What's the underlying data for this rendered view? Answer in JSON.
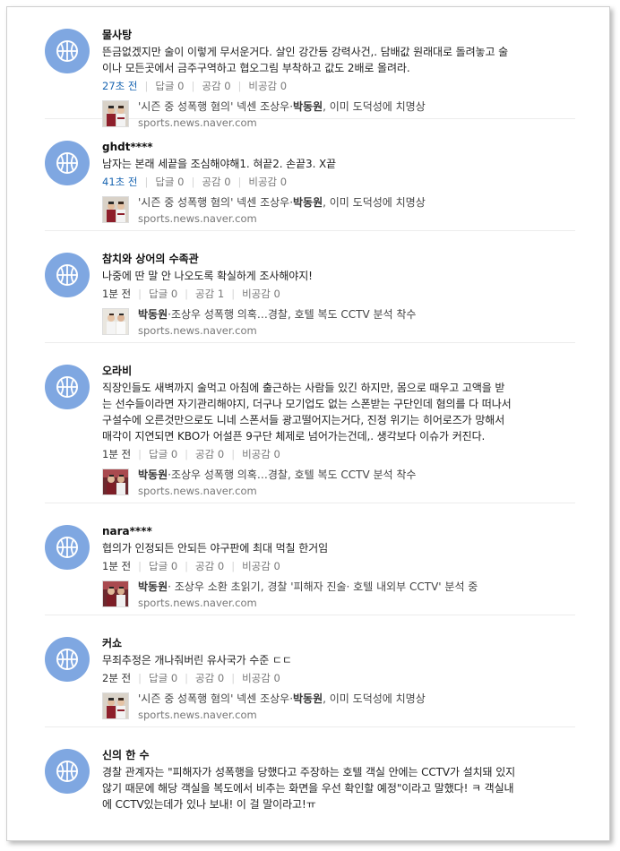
{
  "labels": {
    "reply": "답글",
    "like": "공감",
    "dislike": "비공감"
  },
  "colors": {
    "avatar_bg": "#7fa7e1",
    "recent_time": "#1a66b2"
  },
  "comments": [
    {
      "nick": "물사탕",
      "lines": [
        "뜬금없겠지만 술이 이렇게 무서운거다. 살인 강간등 강력사건,. 담배값 원래대로 돌려놓고 술",
        "이나 모든곳에서 금주구역하고 협오그림 부착하고 값도 2배로 올려라."
      ],
      "time": "27초 전",
      "time_recent": true,
      "replies": "0",
      "likes": "0",
      "dislikes": "0",
      "news": {
        "pre": "'시즌 중 성폭행 혐의' 넥센 조상우·",
        "bold": "박동원",
        "post": ", 이미 도덕성에 치명상",
        "url": "sports.news.naver.com",
        "thumb": "a"
      }
    },
    {
      "nick": "ghdt****",
      "lines": [
        "남자는 본래 세끝을 조심해야해1. 혀끝2. 손끝3. X끝"
      ],
      "time": "41초 전",
      "time_recent": true,
      "replies": "0",
      "likes": "0",
      "dislikes": "0",
      "news": {
        "pre": "'시즌 중 성폭행 혐의' 넥센 조상우·",
        "bold": "박동원",
        "post": ", 이미 도덕성에 치명상",
        "url": "sports.news.naver.com",
        "thumb": "a"
      }
    },
    {
      "nick": "참치와 상어의 수족관",
      "lines": [
        "나중에 딴 말 안 나오도록 확실하게 조사해야지!"
      ],
      "time": "1분 전",
      "time_recent": false,
      "replies": "0",
      "likes": "1",
      "dislikes": "0",
      "news": {
        "pre": "",
        "bold": "박동원",
        "post": "·조상우 성폭행 의혹…경찰, 호텔 복도 CCTV 분석 착수",
        "url": "sports.news.naver.com",
        "thumb": "b"
      }
    },
    {
      "nick": "오라비",
      "lines": [
        "직장인들도 새벽까지 술먹고 아침에 출근하는 사람들 있긴 하지만, 몸으로 때우고 고액을 받",
        "는 선수들이라면 자기관리해야지, 더구나 모기업도 없는 스폰받는 구단인데 혐의를 다 떠나서",
        "구설수에 오른것만으로도 니네 스폰서들 광고떨어지는거다, 진정 위기는 히어로즈가 망해서",
        "매각이 지연되면 KBO가 어설픈 9구단 체제로 넘어가는건데,. 생각보다 이슈가 커진다."
      ],
      "time": "1분 전",
      "time_recent": false,
      "replies": "0",
      "likes": "0",
      "dislikes": "0",
      "news": {
        "pre": "",
        "bold": "박동원",
        "post": "·조상우 성폭행 의혹…경찰, 호텔 복도 CCTV 분석 착수",
        "url": "sports.news.naver.com",
        "thumb": "c"
      }
    },
    {
      "nick": "nara****",
      "lines": [
        "협의가 인정되든 안되든 야구판에 최대 먹칠 한거임"
      ],
      "time": "1분 전",
      "time_recent": false,
      "replies": "0",
      "likes": "0",
      "dislikes": "0",
      "news": {
        "pre": "",
        "bold": "박동원",
        "post": "· 조상우 소환 초읽기, 경찰 '피해자 진술· 호텔 내외부 CCTV' 분석 중",
        "url": "sports.news.naver.com",
        "thumb": "c"
      }
    },
    {
      "nick": "커쇼",
      "lines": [
        "무죄추정은 개나줘버린 유사국가 수준 ㄷㄷ"
      ],
      "time": "2분 전",
      "time_recent": false,
      "replies": "0",
      "likes": "0",
      "dislikes": "0",
      "news": {
        "pre": "'시즌 중 성폭행 혐의' 넥센 조상우·",
        "bold": "박동원",
        "post": ", 이미 도덕성에 치명상",
        "url": "sports.news.naver.com",
        "thumb": "a"
      }
    },
    {
      "nick": "신의 한 수",
      "lines": [
        "경찰 관계자는 \"피해자가 성폭행을 당했다고 주장하는 호텔 객실 안에는 CCTV가 설치돼 있지",
        "않기 때문에 해당 객실을 복도에서 비추는 화면을 우선 확인할 예정\"이라고 말했다! ㅋ 객실내",
        "에 CCTV있는데가 있나 보내! 이 걸 말이라고!ㅠ"
      ],
      "time": "",
      "time_recent": false,
      "replies": "",
      "likes": "",
      "dislikes": "",
      "news": null
    }
  ]
}
